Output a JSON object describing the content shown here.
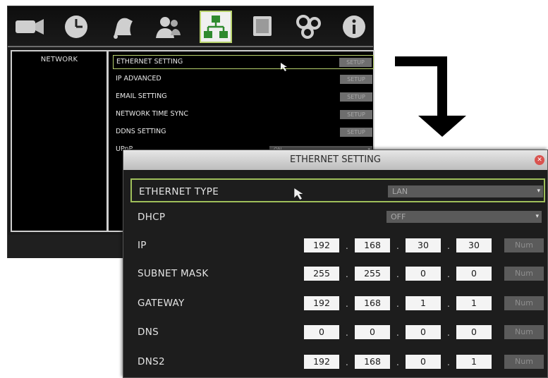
{
  "back_window": {
    "toolbar": {
      "icons": [
        "camera-icon",
        "clock-icon",
        "bell-icon",
        "users-icon",
        "network-icon",
        "monitor-icon",
        "gears-icon",
        "info-icon"
      ],
      "active_icon": "network-icon"
    },
    "nav": {
      "title": "NETWORK"
    },
    "menu": {
      "items": [
        {
          "label": "ETHERNET SETTING",
          "button": "SETUP",
          "selected": true
        },
        {
          "label": "IP ADVANCED",
          "button": "SETUP"
        },
        {
          "label": "EMAIL SETTING",
          "button": "SETUP"
        },
        {
          "label": "NETWORK TIME SYNC",
          "button": "SETUP"
        },
        {
          "label": "DDNS SETTING",
          "button": "SETUP"
        }
      ],
      "upnp": {
        "label": "UPnP",
        "value": "ON"
      }
    }
  },
  "dialog": {
    "title": "ETHERNET SETTING",
    "ethernet_type": {
      "label": "ETHERNET TYPE",
      "value": "LAN"
    },
    "dhcp": {
      "label": "DHCP",
      "value": "OFF"
    },
    "num_label": "Num",
    "ip": {
      "label": "IP",
      "octets": [
        "192",
        "168",
        "30",
        "30"
      ]
    },
    "subnet": {
      "label": "SUBNET MASK",
      "octets": [
        "255",
        "255",
        "0",
        "0"
      ]
    },
    "gateway": {
      "label": "GATEWAY",
      "octets": [
        "192",
        "168",
        "1",
        "1"
      ]
    },
    "dns": {
      "label": "DNS",
      "octets": [
        "0",
        "0",
        "0",
        "0"
      ]
    },
    "dns2": {
      "label": "DNS2",
      "octets": [
        "192",
        "168",
        "0",
        "1"
      ]
    }
  },
  "colors": {
    "highlight": "#b9d36e",
    "panel_bg": "#000000",
    "dialog_bg": "#1d1d1d",
    "arrow": "#000000"
  }
}
